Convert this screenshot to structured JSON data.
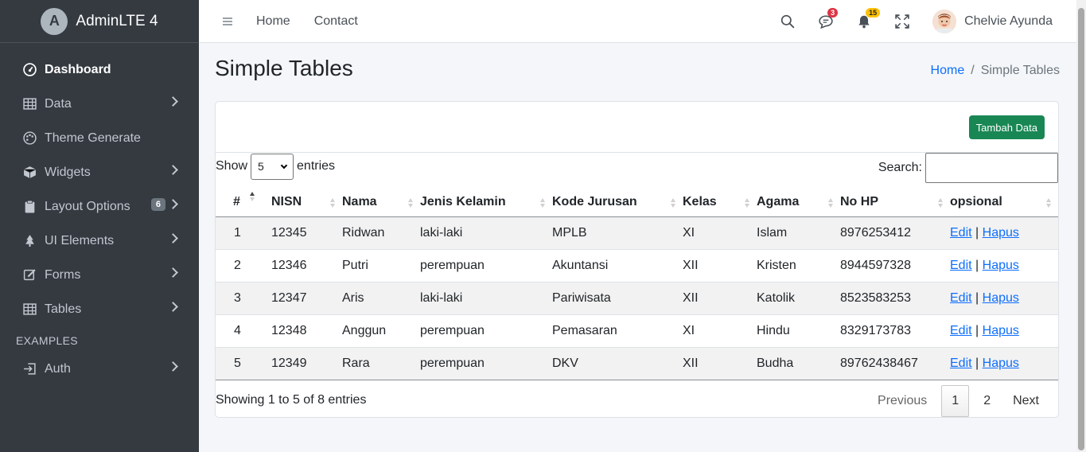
{
  "brand": {
    "name": "AdminLTE 4",
    "logo_letter": "A"
  },
  "sidebar": {
    "items": [
      {
        "label": "Dashboard",
        "icon": "speedometer-icon",
        "active": true
      },
      {
        "label": "Data",
        "icon": "table-icon",
        "chevron": true
      },
      {
        "label": "Theme Generate",
        "icon": "palette-icon"
      },
      {
        "label": "Widgets",
        "icon": "box-icon",
        "chevron": true
      },
      {
        "label": "Layout Options",
        "icon": "clipboard-icon",
        "chevron": true,
        "badge": "6"
      },
      {
        "label": "UI Elements",
        "icon": "tree-icon",
        "chevron": true
      },
      {
        "label": "Forms",
        "icon": "pencil-square-icon",
        "chevron": true
      },
      {
        "label": "Tables",
        "icon": "table-icon",
        "chevron": true
      }
    ],
    "section_header": "EXAMPLES",
    "auth": {
      "label": "Auth",
      "icon": "login-icon",
      "chevron": true
    }
  },
  "topbar": {
    "links": [
      "Home",
      "Contact"
    ],
    "messages_badge": "3",
    "notifications_badge": "15",
    "user_name": "Chelvie Ayunda"
  },
  "page": {
    "title": "Simple Tables",
    "breadcrumb_home": "Home",
    "breadcrumb_sep": "/",
    "breadcrumb_current": "Simple Tables"
  },
  "card": {
    "add_button": "Tambah Data",
    "show_label": "Show",
    "entries_value": "5",
    "entries_label": "entries",
    "search_label": "Search:",
    "search_value": ""
  },
  "table": {
    "columns": [
      "#",
      "NISN",
      "Nama",
      "Jenis Kelamin",
      "Kode Jurusan",
      "Kelas",
      "Agama",
      "No HP",
      "opsional"
    ],
    "rows": [
      [
        "1",
        "12345",
        "Ridwan",
        "laki-laki",
        "MPLB",
        "XI",
        "Islam",
        "8976253412"
      ],
      [
        "2",
        "12346",
        "Putri",
        "perempuan",
        "Akuntansi",
        "XII",
        "Kristen",
        "8944597328"
      ],
      [
        "3",
        "12347",
        "Aris",
        "laki-laki",
        "Pariwisata",
        "XII",
        "Katolik",
        "8523583253"
      ],
      [
        "4",
        "12348",
        "Anggun",
        "perempuan",
        "Pemasaran",
        "XI",
        "Hindu",
        "8329173783"
      ],
      [
        "5",
        "12349",
        "Rara",
        "perempuan",
        "DKV",
        "XII",
        "Budha",
        "89762438467"
      ]
    ],
    "edit_label": "Edit",
    "action_sep": "|",
    "delete_label": "Hapus"
  },
  "footer": {
    "info": "Showing 1 to 5 of 8 entries",
    "previous": "Previous",
    "pages": [
      "1",
      "2"
    ],
    "current_page": "1",
    "next": "Next"
  },
  "colors": {
    "sidebar_bg": "#343a40",
    "accent": "#0d6efd",
    "success": "#198754",
    "badge_danger": "#dc3545",
    "badge_warning": "#ffc107"
  }
}
